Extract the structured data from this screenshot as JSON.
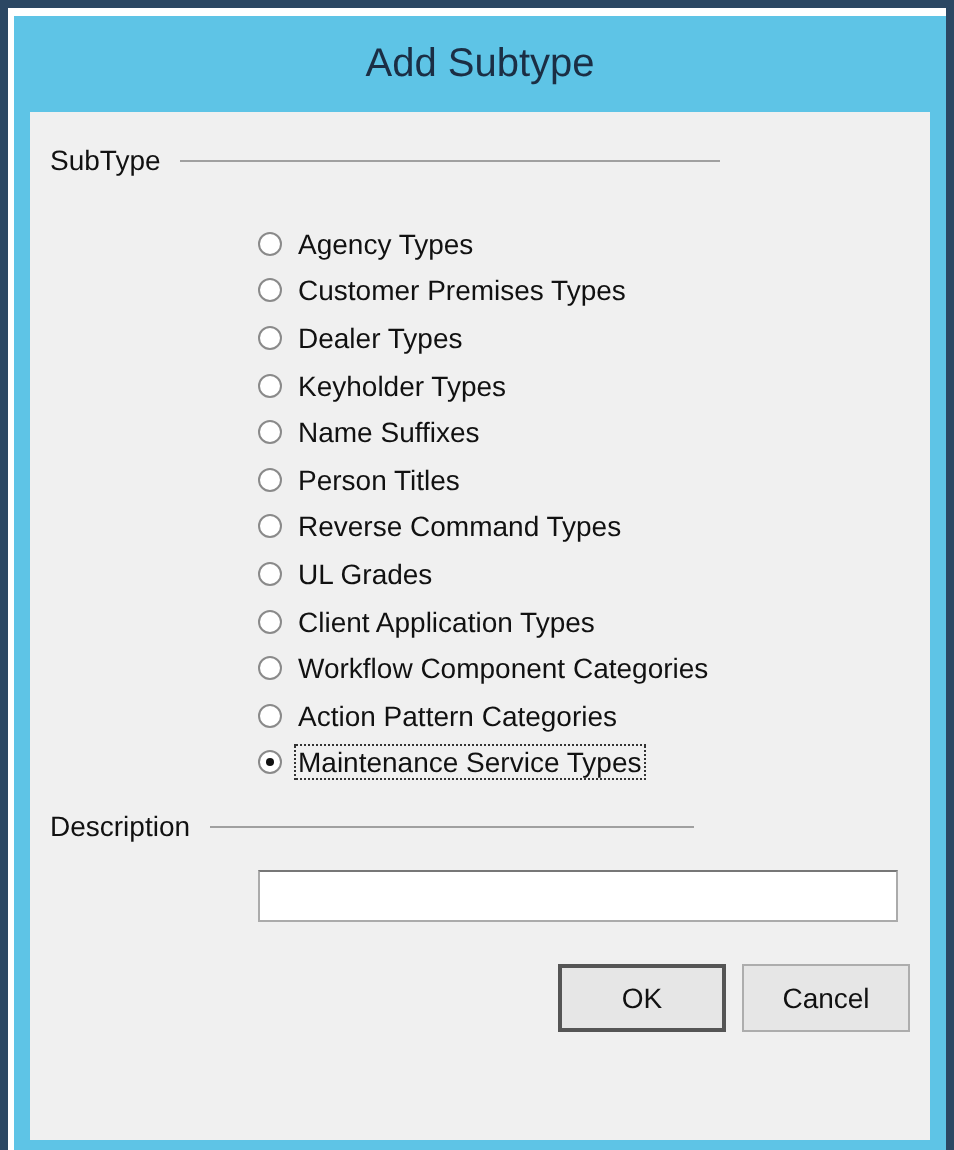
{
  "window": {
    "title": "Add Subtype"
  },
  "subtype_group": {
    "label": "SubType",
    "options": [
      {
        "label": "Agency Types",
        "selected": false,
        "focused": false
      },
      {
        "label": "Customer Premises Types",
        "selected": false,
        "focused": false
      },
      {
        "label": "Dealer Types",
        "selected": false,
        "focused": false
      },
      {
        "label": "Keyholder Types",
        "selected": false,
        "focused": false
      },
      {
        "label": "Name Suffixes",
        "selected": false,
        "focused": false
      },
      {
        "label": "Person Titles",
        "selected": false,
        "focused": false
      },
      {
        "label": "Reverse Command Types",
        "selected": false,
        "focused": false
      },
      {
        "label": "UL Grades",
        "selected": false,
        "focused": false
      },
      {
        "label": "Client Application Types",
        "selected": false,
        "focused": false
      },
      {
        "label": "Workflow Component Categories",
        "selected": false,
        "focused": false
      },
      {
        "label": "Action Pattern Categories",
        "selected": false,
        "focused": false
      },
      {
        "label": "Maintenance Service Types",
        "selected": true,
        "focused": true
      }
    ]
  },
  "description": {
    "label": "Description"
  },
  "buttons": [
    {
      "label": "OK",
      "kind": "default"
    },
    {
      "label": "Cancel",
      "kind": "normal"
    }
  ]
}
